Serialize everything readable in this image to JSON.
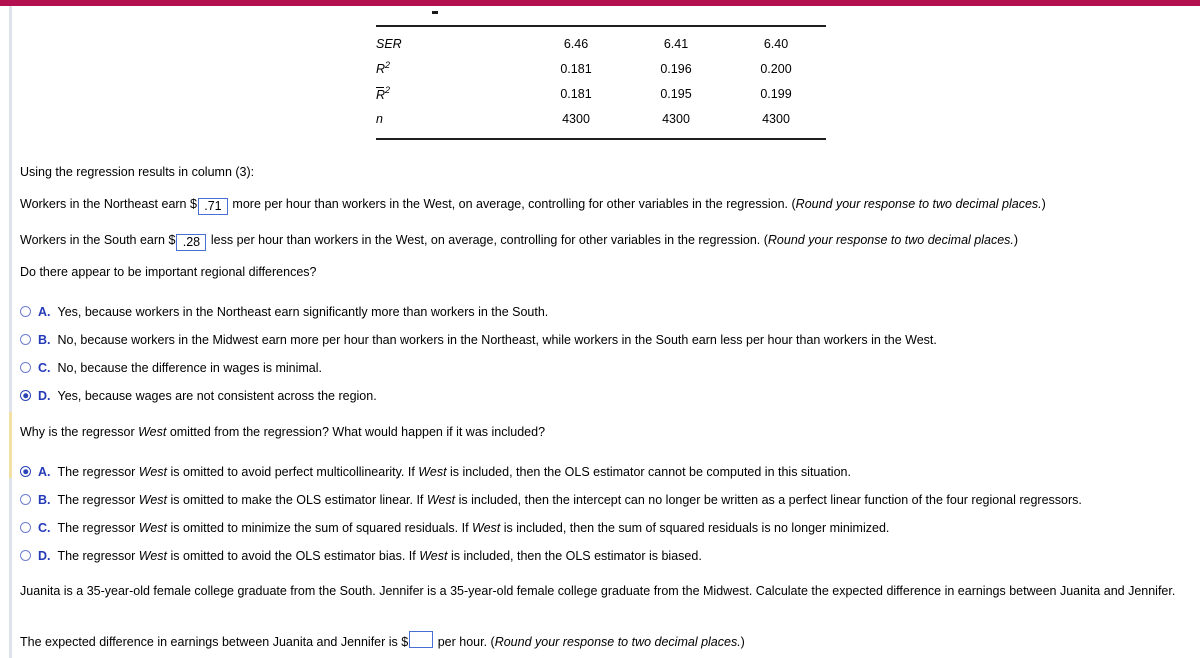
{
  "theme": {
    "top_bar_color": "#b2104f",
    "accent_blue": "#2439b8",
    "input_border": "#4a6fd4",
    "active_marker_color": "#f2dfa3"
  },
  "regression_table": {
    "row_labels": [
      "SER",
      "R2",
      "R2bar",
      "n"
    ],
    "rows": [
      {
        "label": "SER",
        "values": [
          "6.46",
          "6.41",
          "6.40"
        ]
      },
      {
        "label": "R",
        "sup": "2",
        "overbar": false,
        "values": [
          "0.181",
          "0.196",
          "0.200"
        ]
      },
      {
        "label": "R",
        "sup": "2",
        "overbar": true,
        "values": [
          "0.181",
          "0.195",
          "0.199"
        ]
      },
      {
        "label": "n",
        "values": [
          "4300",
          "4300",
          "4300"
        ]
      }
    ],
    "ser_label": "SER",
    "ser_values": [
      "6.46",
      "6.41",
      "6.40"
    ],
    "r2_letter": "R",
    "r2_sup": "2",
    "r2_values": [
      "0.181",
      "0.196",
      "0.200"
    ],
    "r2bar_letter": "R",
    "r2bar_sup": "2",
    "r2bar_values": [
      "0.181",
      "0.195",
      "0.199"
    ],
    "n_label": "n",
    "n_values": [
      "4300",
      "4300",
      "4300"
    ]
  },
  "intro": {
    "line": "Using the regression results in column (3):"
  },
  "fill_in_1": {
    "prefix": "Workers in the Northeast earn $",
    "value": ".71",
    "middle": "more per hour than workers in the West, on average, controlling for other variables in the regression. (",
    "italic_note": "Round your response to two decimal places.",
    "suffix": ")"
  },
  "fill_in_2": {
    "prefix": "Workers in the South earn $",
    "value": ".28",
    "middle": "less per hour than workers in the West, on average, controlling for other variables in the regression. (",
    "italic_note": "Round your response to two decimal places.",
    "suffix": ")"
  },
  "question_1": {
    "prompt": "Do there appear to be important regional differences?",
    "selected": "D",
    "options": [
      {
        "letter": "A.",
        "text": "Yes, because workers in the Northeast earn significantly more than workers in the South."
      },
      {
        "letter": "B.",
        "text": "No, because workers in the Midwest earn more per hour than workers in the Northeast, while workers in the South earn less per hour than workers in the West."
      },
      {
        "letter": "C.",
        "text": "No, because the difference in wages is minimal."
      },
      {
        "letter": "D.",
        "text": "Yes, because wages are not consistent across the region."
      }
    ]
  },
  "question_2": {
    "prompt_part1": "Why is the regressor ",
    "prompt_italic": "West",
    "prompt_part2": " omitted from the regression? What would happen if it was included?",
    "selected": "A",
    "options": [
      {
        "letter": "A.",
        "seg1": "The regressor ",
        "it1": "West",
        "seg2": " is omitted to avoid perfect multicollinearity. If ",
        "it2": "West",
        "seg3": " is included, then the OLS estimator cannot be computed in this situation."
      },
      {
        "letter": "B.",
        "seg1": "The regressor ",
        "it1": "West",
        "seg2": " is omitted to make the OLS estimator linear. If ",
        "it2": "West",
        "seg3": " is included, then the intercept can no longer be written as a perfect linear function of the four regional regressors."
      },
      {
        "letter": "C.",
        "seg1": "The regressor ",
        "it1": "West",
        "seg2": " is omitted to minimize the sum of squared residuals. If ",
        "it2": "West",
        "seg3": " is included, then the sum of squared residuals is no longer minimized."
      },
      {
        "letter": "D.",
        "seg1": "The regressor ",
        "it1": "West",
        "seg2": " is omitted to avoid the OLS estimator bias. If ",
        "it2": "West",
        "seg3": " is included, then the OLS estimator is biased."
      }
    ]
  },
  "scenario": {
    "line1": "Juanita is a 35-year-old female college graduate from the South. Jennifer is a 35-year-old female college graduate from the Midwest. Calculate the expected difference in earnings between Juanita",
    "line2": "and Jennifer."
  },
  "fill_in_3": {
    "prefix": "The expected difference in earnings between Juanita and Jennifer is $",
    "value": "",
    "middle": "per hour. (",
    "italic_note": "Round your response to two decimal places.",
    "suffix": ")"
  }
}
